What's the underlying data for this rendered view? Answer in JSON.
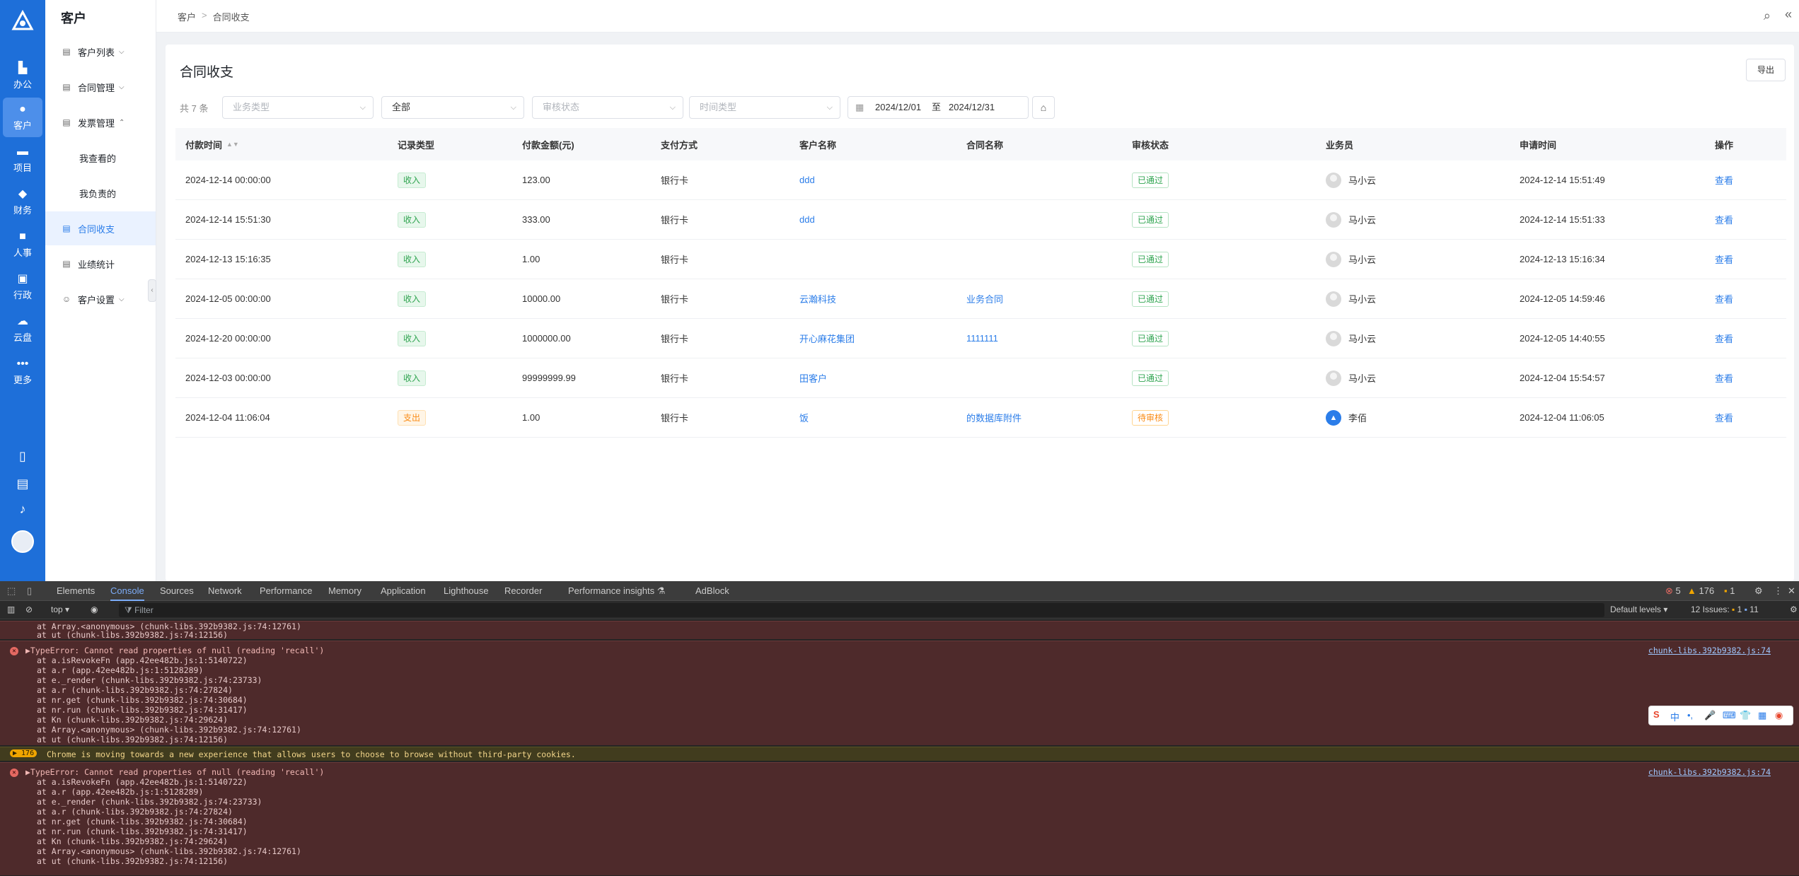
{
  "rail": {
    "items": [
      {
        "icon": "office-icon",
        "glyph": "▙",
        "label": "办公"
      },
      {
        "icon": "customer-icon",
        "glyph": "●",
        "label": "客户"
      },
      {
        "icon": "project-icon",
        "glyph": "▬",
        "label": "项目"
      },
      {
        "icon": "finance-icon",
        "glyph": "◆",
        "label": "财务"
      },
      {
        "icon": "hr-icon",
        "glyph": "■",
        "label": "人事"
      },
      {
        "icon": "admin-icon",
        "glyph": "▣",
        "label": "行政"
      },
      {
        "icon": "cloud-icon",
        "glyph": "☁",
        "label": "云盘"
      },
      {
        "icon": "more-icon",
        "glyph": "•••",
        "label": "更多"
      }
    ]
  },
  "sidebar": {
    "title": "客户",
    "menu": [
      {
        "label": "客户列表",
        "icon": "▤"
      },
      {
        "label": "合同管理",
        "icon": "▤"
      },
      {
        "label": "发票管理",
        "icon": "▤"
      },
      {
        "label": "我查看的"
      },
      {
        "label": "我负责的"
      },
      {
        "label": "合同收支",
        "icon": "▤"
      },
      {
        "label": "业绩统计",
        "icon": "▤"
      },
      {
        "label": "客户设置",
        "icon": "☺"
      }
    ]
  },
  "breadcrumb": {
    "root": "客户",
    "sep": ">",
    "current": "合同收支"
  },
  "page": {
    "title": "合同收支",
    "export": "导出",
    "count": "共 7 条",
    "filters": {
      "business_type": "业务类型",
      "all": "全部",
      "audit_status": "审核状态",
      "time_type": "时间类型",
      "date_start": "2024/12/01",
      "date_to": "至",
      "date_end": "2024/12/31"
    }
  },
  "table": {
    "headers": [
      "付款时间",
      "记录类型",
      "付款金额(元)",
      "支付方式",
      "客户名称",
      "合同名称",
      "审核状态",
      "业务员",
      "申请时间",
      "操作"
    ],
    "rows": [
      {
        "pay_time": "2024-12-14 00:00:00",
        "type": "收入",
        "type_kind": "in",
        "amount": "123.00",
        "method": "银行卡",
        "customer": "ddd",
        "contract": "",
        "status": "已通过",
        "status_kind": "ok",
        "staff": "马小云",
        "avatar": "gray",
        "apply_time": "2024-12-14 15:51:49",
        "action": "查看"
      },
      {
        "pay_time": "2024-12-14 15:51:30",
        "type": "收入",
        "type_kind": "in",
        "amount": "333.00",
        "method": "银行卡",
        "customer": "ddd",
        "contract": "",
        "status": "已通过",
        "status_kind": "ok",
        "staff": "马小云",
        "avatar": "gray",
        "apply_time": "2024-12-14 15:51:33",
        "action": "查看"
      },
      {
        "pay_time": "2024-12-13 15:16:35",
        "type": "收入",
        "type_kind": "in",
        "amount": "1.00",
        "method": "银行卡",
        "customer": "",
        "contract": "",
        "status": "已通过",
        "status_kind": "ok",
        "staff": "马小云",
        "avatar": "gray",
        "apply_time": "2024-12-13 15:16:34",
        "action": "查看"
      },
      {
        "pay_time": "2024-12-05 00:00:00",
        "type": "收入",
        "type_kind": "in",
        "amount": "10000.00",
        "method": "银行卡",
        "customer": "云瀚科技",
        "contract": "业务合同",
        "status": "已通过",
        "status_kind": "ok",
        "staff": "马小云",
        "avatar": "gray",
        "apply_time": "2024-12-05 14:59:46",
        "action": "查看"
      },
      {
        "pay_time": "2024-12-20 00:00:00",
        "type": "收入",
        "type_kind": "in",
        "amount": "1000000.00",
        "method": "银行卡",
        "customer": "开心麻花集团",
        "contract": "1111111",
        "status": "已通过",
        "status_kind": "ok",
        "staff": "马小云",
        "avatar": "gray",
        "apply_time": "2024-12-05 14:40:55",
        "action": "查看"
      },
      {
        "pay_time": "2024-12-03 00:00:00",
        "type": "收入",
        "type_kind": "in",
        "amount": "99999999.99",
        "method": "银行卡",
        "customer": "田客户",
        "contract": "",
        "status": "已通过",
        "status_kind": "ok",
        "staff": "马小云",
        "avatar": "gray",
        "apply_time": "2024-12-04 15:54:57",
        "action": "查看"
      },
      {
        "pay_time": "2024-12-04 11:06:04",
        "type": "支出",
        "type_kind": "out",
        "amount": "1.00",
        "method": "银行卡",
        "customer": "饭",
        "contract": "的数据库附件",
        "status": "待审核",
        "status_kind": "wait",
        "staff": "李佰",
        "avatar": "blue",
        "apply_time": "2024-12-04 11:06:05",
        "action": "查看"
      }
    ]
  },
  "devtools": {
    "tabs": [
      "Elements",
      "Console",
      "Sources",
      "Network",
      "Performance",
      "Memory",
      "Application",
      "Lighthouse",
      "Recorder",
      "Performance insights ⚗",
      "AdBlock"
    ],
    "counts": {
      "errors": "5",
      "warnings": "176",
      "info": "1"
    },
    "context": "top ▾",
    "filter_placeholder": "Filter",
    "levels": "Default levels ▾",
    "issues": "12 Issues:",
    "issues_a": "1",
    "issues_b": "11",
    "top_lines": [
      "at Array.<anonymous> (chunk-libs.392b9382.js:74:12761)",
      "at ut (chunk-libs.392b9382.js:74:12156)"
    ],
    "error_head": "▶TypeError: Cannot read properties of null (reading 'recall')",
    "error_src": "chunk-libs.392b9382.js:74",
    "stack": [
      "at a.isRevokeFn (app.42ee482b.js:1:5140722)",
      "at a.r (app.42ee482b.js:1:5128289)",
      "at e._render (chunk-libs.392b9382.js:74:23733)",
      "at a.r (chunk-libs.392b9382.js:74:27824)",
      "at nr.get (chunk-libs.392b9382.js:74:30684)",
      "at nr.run (chunk-libs.392b9382.js:74:31417)",
      "at Kn (chunk-libs.392b9382.js:74:29624)",
      "at Array.<anonymous> (chunk-libs.392b9382.js:74:12761)",
      "at ut (chunk-libs.392b9382.js:74:12156)"
    ],
    "warn_count": "▶ 176",
    "warn_text": "Chrome is moving towards a new experience that allows users to choose to browse without third-party cookies."
  },
  "ime": {
    "labels": [
      "中",
      "•,",
      "🎤",
      "⌨",
      "👕",
      "▦",
      "◉"
    ]
  }
}
